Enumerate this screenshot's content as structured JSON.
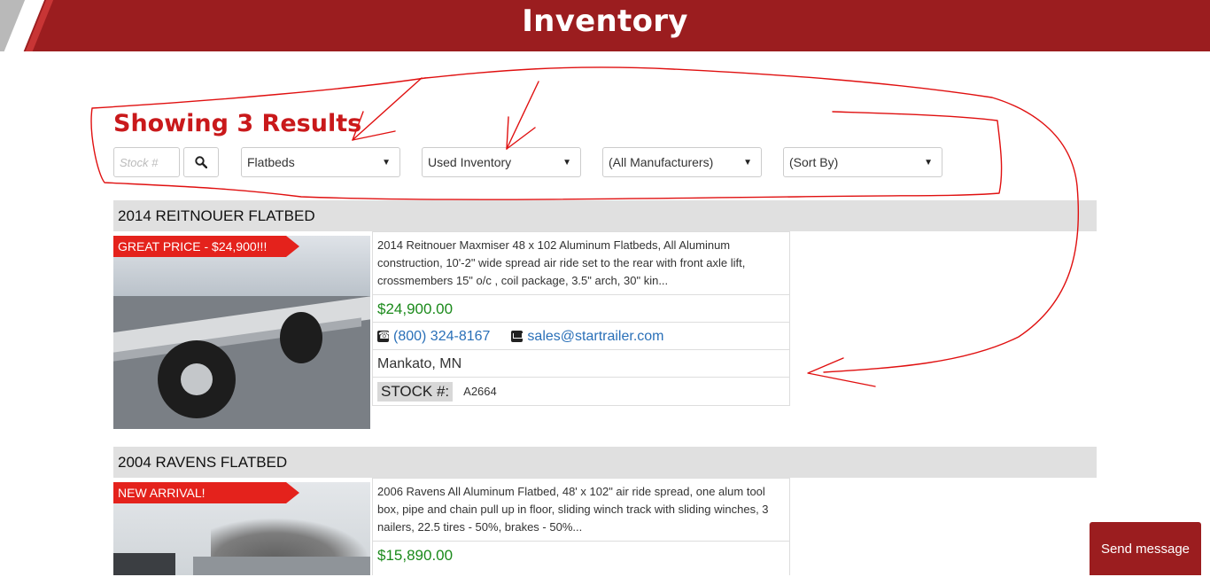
{
  "page": {
    "title": "Inventory"
  },
  "results": {
    "heading": "Showing 3 Results"
  },
  "filters": {
    "stock_placeholder": "Stock #",
    "trailer_type": "Flatbeds",
    "condition": "Used Inventory",
    "manufacturer": "(All Manufacturers)",
    "sort": "(Sort By)"
  },
  "listings": [
    {
      "title": "2014 REITNOUER FLATBED",
      "badge": "GREAT PRICE - $24,900!!!",
      "description": "2014 Reitnouer Maxmiser 48 x 102 Aluminum Flatbeds, All Aluminum construction, 10'-2\" wide spread air ride set to the rear with front axle lift, crossmembers 15\" o/c , coil package, 3.5\" arch, 30\" kin...",
      "price": "$24,900.00",
      "phone": "(800) 324-8167",
      "email": "sales@startrailer.com",
      "location": "Mankato, MN",
      "stock_label": "STOCK #:",
      "stock_number": "A2664"
    },
    {
      "title": "2004 RAVENS FLATBED",
      "badge": "NEW ARRIVAL!",
      "description": "2006 Ravens All Aluminum Flatbed, 48' x 102\" air ride spread, one alum tool box, pipe and chain pull up in floor, sliding winch track with sliding winches, 3 nailers, 22.5 tires - 50%, brakes - 50%...",
      "price": "$15,890.00"
    }
  ],
  "chat": {
    "send_label": "Send message"
  },
  "colors": {
    "brand_red": "#9b1d1f",
    "heading_red": "#c9191b",
    "price_green": "#1b8a1b",
    "link_blue": "#2a70b8",
    "badge_red": "#e4221c"
  },
  "icons": [
    "search-icon",
    "caret-down-icon",
    "phone-icon",
    "mail-icon"
  ]
}
